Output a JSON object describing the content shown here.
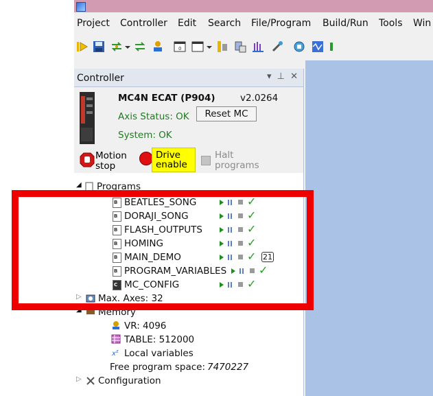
{
  "menubar": {
    "items": [
      "Project",
      "Controller",
      "Edit",
      "Search",
      "File/Program",
      "Build/Run",
      "Tools",
      "Win"
    ]
  },
  "panel": {
    "title": "Controller",
    "controls": "▾ ⊥ ✕"
  },
  "controller": {
    "name": "MC4N ECAT (P904)",
    "version": "v2.0264",
    "axis_status": "Axis Status: OK",
    "reset_button": "Reset MC",
    "system_status": "System: OK",
    "motion_stop": {
      "line1": "Motion",
      "line2": "stop"
    },
    "drive_enable": {
      "line1": "Drive",
      "line2": "enable"
    },
    "halt_programs": {
      "line1": "Halt",
      "line2": "programs"
    }
  },
  "tree": {
    "programs_label": "Programs",
    "programs": [
      {
        "name": "BEATLES_SONG"
      },
      {
        "name": "DORAJI_SONG"
      },
      {
        "name": "FLASH_OUTPUTS"
      },
      {
        "name": "HOMING"
      },
      {
        "name": "MAIN_DEMO",
        "badge": "21"
      },
      {
        "name": "PROGRAM_VARIABLES"
      },
      {
        "name": "MC_CONFIG"
      }
    ],
    "max_axes": "Max. Axes: 32",
    "memory_label": "Memory",
    "vr": "VR: 4096",
    "table": "TABLE: 512000",
    "local_variables": "Local variables",
    "free_space_label": "Free program space:",
    "free_space_value": "7470227",
    "configuration": "Configuration"
  },
  "colors": {
    "highlight_border": "#ee0000",
    "drive_enable_bg": "#ffff00",
    "status_ok": "#1f7a1f",
    "dock_bg": "#a9c2e6"
  }
}
